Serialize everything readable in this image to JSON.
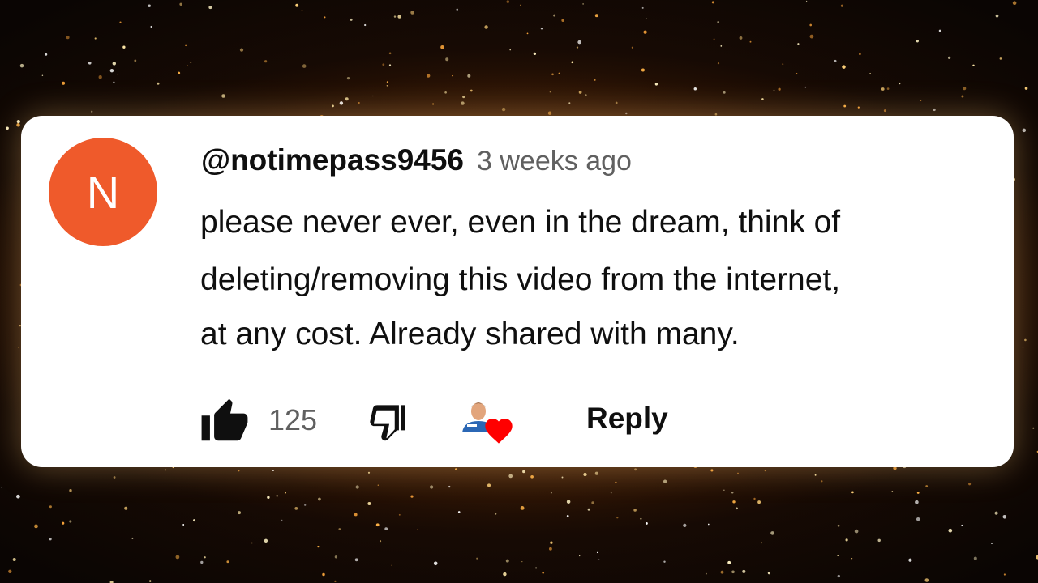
{
  "comment": {
    "avatar_letter": "N",
    "avatar_color": "#ef5a2b",
    "username": "@notimepass9456",
    "timestamp": "3 weeks ago",
    "text_lines": [
      "please never ever, even in the dream, think of",
      "deleting/removing this video from the internet,",
      "at any cost. Already shared with many."
    ]
  },
  "actions": {
    "like_icon": "thumbs-up-filled-icon",
    "like_count": "125",
    "dislike_icon": "thumbs-down-outline-icon",
    "creator_heart_icon": "creator-heart-icon",
    "heart_color": "#ff0000",
    "reply_label": "Reply"
  },
  "background": {
    "style": "golden-glitter",
    "accent_color": "#f2a440"
  }
}
